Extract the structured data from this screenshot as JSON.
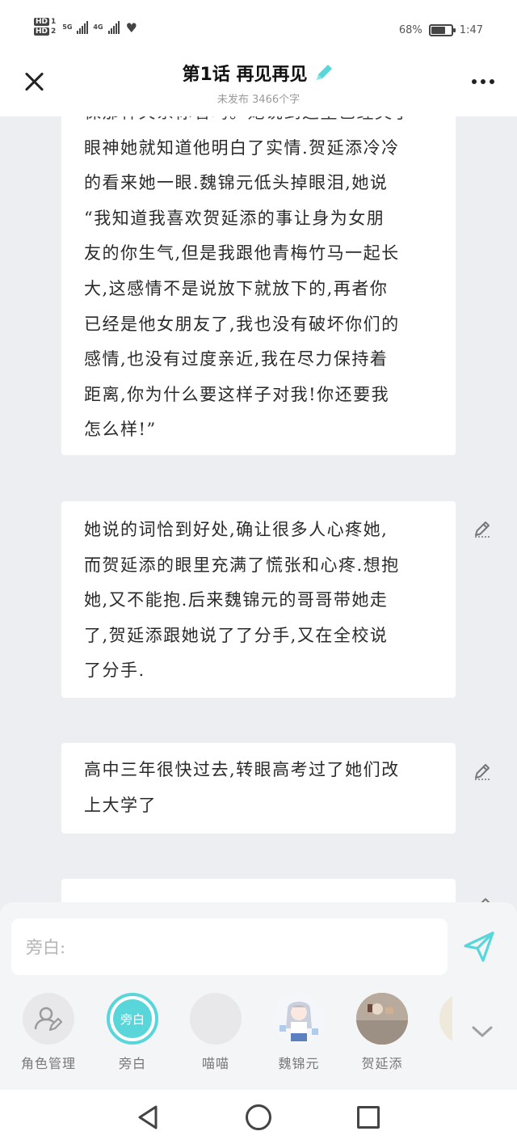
{
  "status_bar": {
    "hd1": "HD",
    "hd1_sub": "1",
    "hd2": "HD",
    "hd2_sub": "2",
    "net1": "5G",
    "net2": "4G",
    "battery_percent": "68%",
    "battery_level": 0.68,
    "time": "1:47"
  },
  "header": {
    "title": "第1话 再见再见",
    "subtitle": "未发布 3466个字",
    "accent_color": "#59d6d9"
  },
  "cards": [
    {
      "lines": [
        "眼神她就知道他明白了实情.贺延添冷冷",
        "的看来她一眼.魏锦元低头掉眼泪,她说",
        "“我知道我喜欢贺延添的事让身为女朋",
        "友的你生气,但是我跟他青梅竹马一起长",
        "大,这感情不是说放下就放下的,再者你",
        "已经是他女朋友了,我也没有破坏你们的",
        "感情,也没有过度亲近,我在尽力保持着",
        "距离,你为什么要这样子对我!你还要我",
        "怎么样!”"
      ]
    },
    {
      "lines": [
        "她说的词恰到好处,确让很多人心疼她,",
        "而贺延添的眼里充满了慌张和心疼.想抱",
        "她,又不能抱.后来魏锦元的哥哥带她走",
        "了,贺延添跟她说了了分手,又在全校说",
        "了分手."
      ]
    },
    {
      "lines": [
        "高中三年很快过去,转眼高考过了她们改",
        "上大学了"
      ]
    }
  ],
  "composer": {
    "placeholder": "旁白:"
  },
  "roles": [
    {
      "label": "角色管理",
      "icon": "person-edit-icon"
    },
    {
      "label": "旁白",
      "badge": "旁白",
      "active": true
    },
    {
      "label": "喵喵"
    },
    {
      "label": "魏锦元",
      "image": "anime-girl-avatar"
    },
    {
      "label": "贺延添",
      "image": "photo-avatar"
    }
  ]
}
